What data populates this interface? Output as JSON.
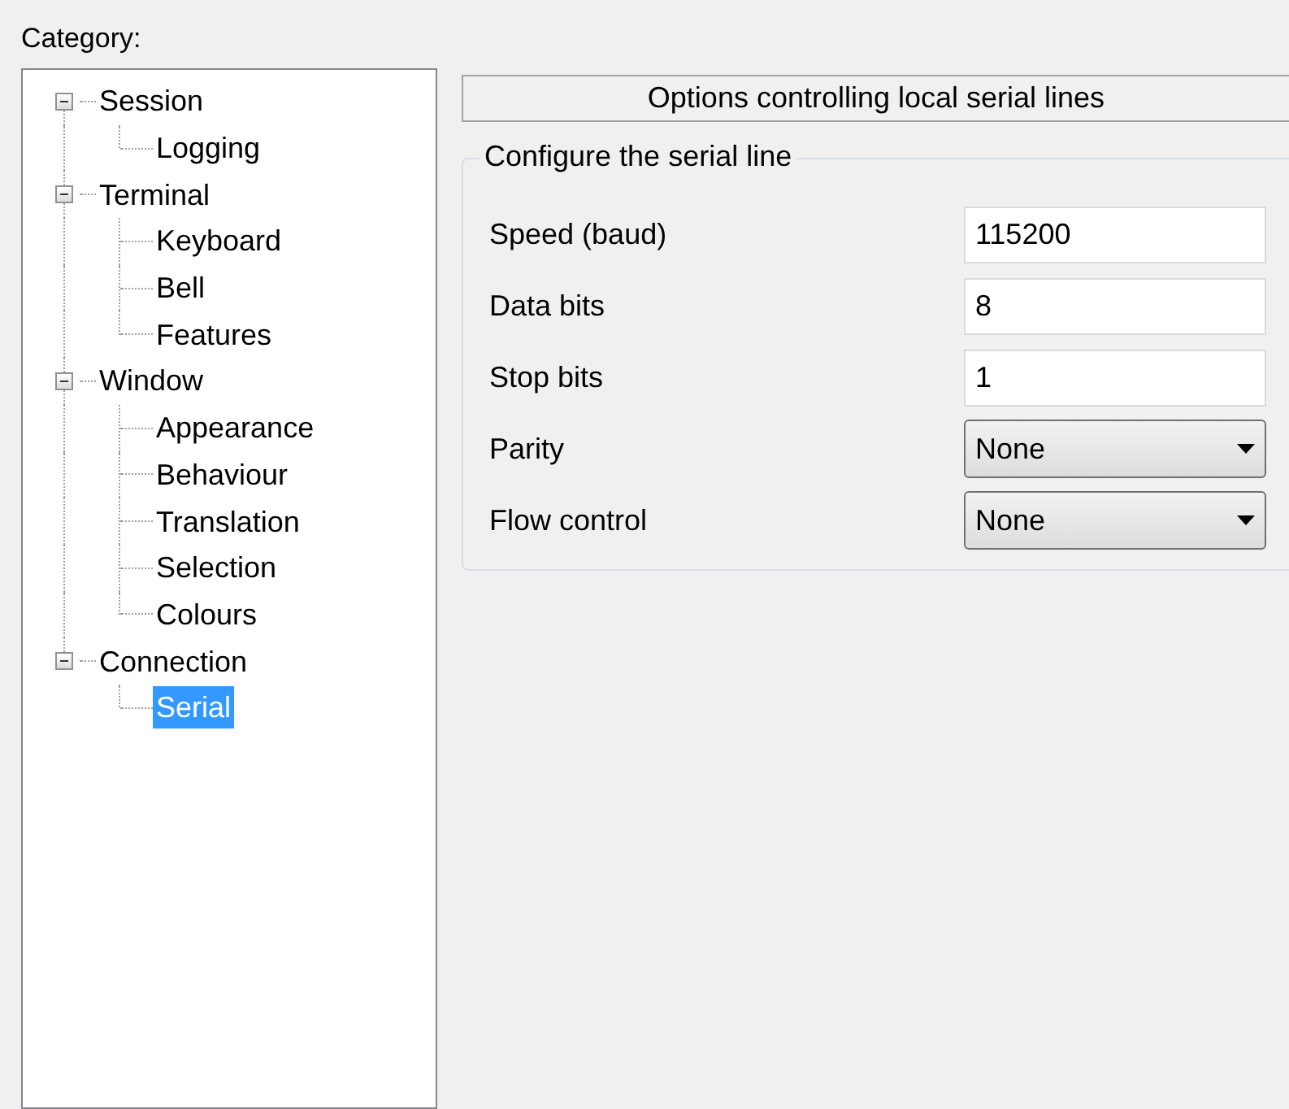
{
  "category_label": "Category:",
  "tree": [
    {
      "label": "Session",
      "expanded": true,
      "selected": false,
      "children": [
        {
          "label": "Logging",
          "selected": false
        }
      ]
    },
    {
      "label": "Terminal",
      "expanded": true,
      "selected": false,
      "children": [
        {
          "label": "Keyboard",
          "selected": false
        },
        {
          "label": "Bell",
          "selected": false
        },
        {
          "label": "Features",
          "selected": false
        }
      ]
    },
    {
      "label": "Window",
      "expanded": true,
      "selected": false,
      "children": [
        {
          "label": "Appearance",
          "selected": false
        },
        {
          "label": "Behaviour",
          "selected": false
        },
        {
          "label": "Translation",
          "selected": false
        },
        {
          "label": "Selection",
          "selected": false
        },
        {
          "label": "Colours",
          "selected": false
        }
      ]
    },
    {
      "label": "Connection",
      "expanded": true,
      "selected": false,
      "children": [
        {
          "label": "Serial",
          "selected": true
        }
      ]
    }
  ],
  "header": "Options controlling local serial lines",
  "group": {
    "title": "Configure the serial line",
    "fields": [
      {
        "label": "Speed (baud)",
        "kind": "text",
        "value": "115200"
      },
      {
        "label": "Data bits",
        "kind": "text",
        "value": "8"
      },
      {
        "label": "Stop bits",
        "kind": "text",
        "value": "1"
      },
      {
        "label": "Parity",
        "kind": "dropdown",
        "value": "None"
      },
      {
        "label": "Flow control",
        "kind": "dropdown",
        "value": "None"
      }
    ]
  }
}
